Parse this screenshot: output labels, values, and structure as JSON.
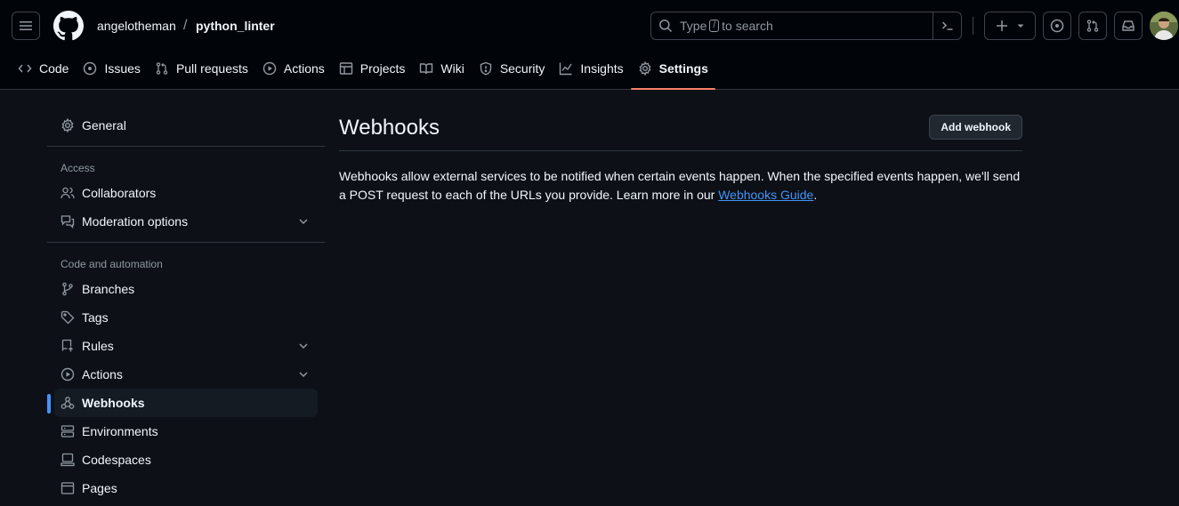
{
  "header": {
    "owner": "angelotheman",
    "separator": "/",
    "repo": "python_linter",
    "search": {
      "prefix": "Type",
      "key": "/",
      "suffix": "to search"
    }
  },
  "tabs": [
    {
      "label": "Code",
      "icon": "code-icon"
    },
    {
      "label": "Issues",
      "icon": "issue-opened-icon"
    },
    {
      "label": "Pull requests",
      "icon": "git-pull-request-icon"
    },
    {
      "label": "Actions",
      "icon": "play-icon"
    },
    {
      "label": "Projects",
      "icon": "table-icon"
    },
    {
      "label": "Wiki",
      "icon": "book-icon"
    },
    {
      "label": "Security",
      "icon": "shield-icon"
    },
    {
      "label": "Insights",
      "icon": "graph-icon"
    },
    {
      "label": "Settings",
      "icon": "gear-icon"
    }
  ],
  "sidebar": {
    "general": "General",
    "access_heading": "Access",
    "collaborators": "Collaborators",
    "moderation": "Moderation options",
    "code_heading": "Code and automation",
    "branches": "Branches",
    "tags": "Tags",
    "rules": "Rules",
    "actions": "Actions",
    "webhooks": "Webhooks",
    "environments": "Environments",
    "codespaces": "Codespaces",
    "pages": "Pages"
  },
  "main": {
    "title": "Webhooks",
    "add_button": "Add webhook",
    "description": "Webhooks allow external services to be notified when certain events happen. When the specified events happen, we'll send a POST request to each of the URLs you provide. Learn more in our ",
    "link": "Webhooks Guide",
    "end": "."
  },
  "colors": {
    "accent": "#4493f8",
    "tab_underline": "#f78166",
    "background": "#0d1117"
  }
}
